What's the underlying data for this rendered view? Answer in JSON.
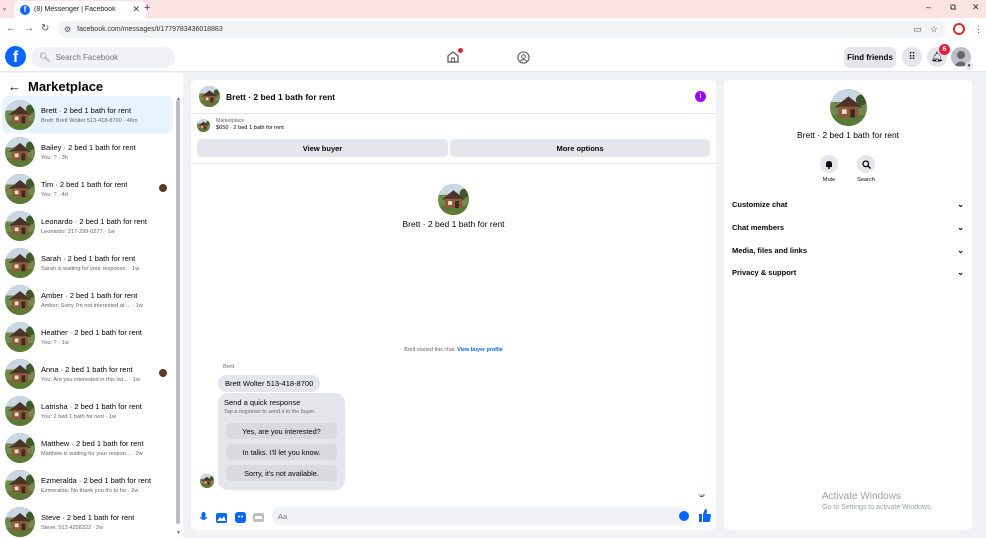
{
  "browser": {
    "tab_title": "(8) Messenger | Facebook",
    "url": "facebook.com/messages/t/1779783436018883"
  },
  "header": {
    "search_placeholder": "Search Facebook",
    "find_friends_label": "Find friends",
    "notification_count": "6"
  },
  "sidebar": {
    "title": "Marketplace",
    "items": [
      {
        "name": "Brett · 2 bed 1 bath for rent",
        "snippet": "Brett: Brett Wolter 513-418-8700 · 46m",
        "active": true,
        "read_avatar": false
      },
      {
        "name": "Bailey · 2 bed 1 bath for rent",
        "snippet": "You: ? · 3h",
        "active": false,
        "read_avatar": false
      },
      {
        "name": "Tim · 2 bed 1 bath for rent",
        "snippet": "You: ? · 4d",
        "active": false,
        "read_avatar": true
      },
      {
        "name": "Leonardo · 2 bed 1 bath for rent",
        "snippet": "Leonardo: 217-299-0277 · 1w",
        "active": false,
        "read_avatar": false
      },
      {
        "name": "Sarah · 2 bed 1 bath for rent",
        "snippet": "Sarah is waiting for your response. · 1w",
        "active": false,
        "read_avatar": false
      },
      {
        "name": "Amber · 2 bed 1 bath for rent",
        "snippet": "Amber: Sorry I'm not interested at ... · 1w",
        "active": false,
        "read_avatar": false
      },
      {
        "name": "Heather · 2 bed 1 bath for rent",
        "snippet": "You: ? · 1w",
        "active": false,
        "read_avatar": false
      },
      {
        "name": "Anna · 2 bed 1 bath for rent",
        "snippet": "You: Are you interested in this list... · 1w",
        "active": false,
        "read_avatar": true
      },
      {
        "name": "Latrisha · 2 bed 1 bath for rent",
        "snippet": "You: 2 bed 1 bath for rent · 1w",
        "active": false,
        "read_avatar": false
      },
      {
        "name": "Matthew · 2 bed 1 bath for rent",
        "snippet": "Matthew is waiting for your respon... · 2w",
        "active": false,
        "read_avatar": false
      },
      {
        "name": "Ezmeralda · 2 bed 1 bath for rent",
        "snippet": "Ezmeralda: No thank you it's to far · 2w",
        "active": false,
        "read_avatar": false
      },
      {
        "name": "Steve · 2 bed 1 bath for rent",
        "snippet": "Steve: 513 4258322 · 2w",
        "active": false,
        "read_avatar": false
      }
    ]
  },
  "chat": {
    "title": "Brett · 2 bed 1 bath for rent",
    "marketplace_label": "Marketplace",
    "listing": "$650 · 2 bed 1 bath for rent",
    "view_buyer_label": "View buyer",
    "more_options_label": "More options",
    "contact_name": "Brett · 2 bed 1 bath for rent",
    "started_text": "Brett started this chat.",
    "view_buyer_profile": "View buyer profile",
    "sender": "Brett",
    "message_text": "Brett Wolter 513-418-8700",
    "quick_response_title": "Send a quick response",
    "quick_response_sub": "Tap a response to send it to the buyer.",
    "quick_options": [
      "Yes, are you interested?",
      "In talks. I'll let you know.",
      "Sorry, it's not available."
    ],
    "composer_placeholder": "Aa"
  },
  "details": {
    "name": "Brett · 2 bed 1 bath for rent",
    "mute_label": "Mute",
    "search_label": "Search",
    "sections": [
      "Customize chat",
      "Chat members",
      "Media, files and links",
      "Privacy & support"
    ]
  },
  "watermark": {
    "line1": "Activate Windows",
    "line2": "Go to Settings to activate Windows."
  },
  "colors": {
    "brand": "#0866ff",
    "active_row": "#e7f3ff",
    "badge": "#e41e3f",
    "info": "#a100ff"
  }
}
